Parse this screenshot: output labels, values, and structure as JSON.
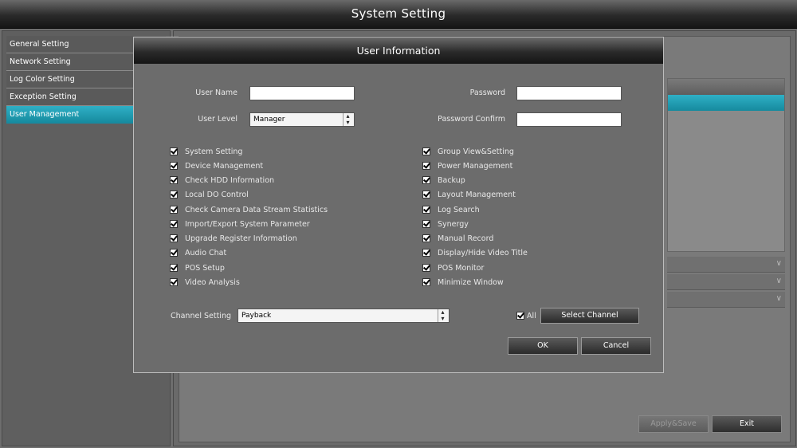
{
  "window": {
    "title": "System Setting"
  },
  "sidebar": {
    "items": [
      {
        "label": "General Setting"
      },
      {
        "label": "Network Setting"
      },
      {
        "label": "Log Color Setting"
      },
      {
        "label": "Exception Setting"
      },
      {
        "label": "User Management"
      }
    ],
    "active_index": 4
  },
  "footer": {
    "apply_label": "Apply&Save",
    "exit_label": "Exit"
  },
  "dialog": {
    "title": "User Information",
    "user_name": {
      "label": "User Name",
      "value": ""
    },
    "password": {
      "label": "Password",
      "value": ""
    },
    "user_level": {
      "label": "User Level",
      "value": "Manager"
    },
    "password_confirm": {
      "label": "Password Confirm",
      "value": ""
    },
    "permissions_left": [
      {
        "label": "System Setting",
        "checked": true
      },
      {
        "label": "Device Management",
        "checked": true
      },
      {
        "label": "Check HDD Information",
        "checked": true
      },
      {
        "label": "Local DO Control",
        "checked": true
      },
      {
        "label": "Check Camera Data Stream Statistics",
        "checked": true
      },
      {
        "label": "Import/Export System Parameter",
        "checked": true
      },
      {
        "label": "Upgrade Register Information",
        "checked": true
      },
      {
        "label": "Audio Chat",
        "checked": true
      },
      {
        "label": "POS Setup",
        "checked": true
      },
      {
        "label": "Video Analysis",
        "checked": true
      }
    ],
    "permissions_right": [
      {
        "label": "Group View&Setting",
        "checked": true
      },
      {
        "label": "Power Management",
        "checked": true
      },
      {
        "label": "Backup",
        "checked": true
      },
      {
        "label": "Layout Management",
        "checked": true
      },
      {
        "label": "Log Search",
        "checked": true
      },
      {
        "label": "Synergy",
        "checked": true
      },
      {
        "label": "Manual Record",
        "checked": true
      },
      {
        "label": "Display/Hide Video Title",
        "checked": true
      },
      {
        "label": "POS Monitor",
        "checked": true
      },
      {
        "label": "Minimize Window",
        "checked": true
      }
    ],
    "channel_setting": {
      "label": "Channel Setting",
      "value": "Payback"
    },
    "all": {
      "label": "All",
      "checked": true
    },
    "select_channel_label": "Select Channel",
    "ok_label": "OK",
    "cancel_label": "Cancel"
  },
  "colors": {
    "accent": "#1e9fb5",
    "title_bar": "#2a2a2a",
    "panel": "#6c6c6c"
  }
}
